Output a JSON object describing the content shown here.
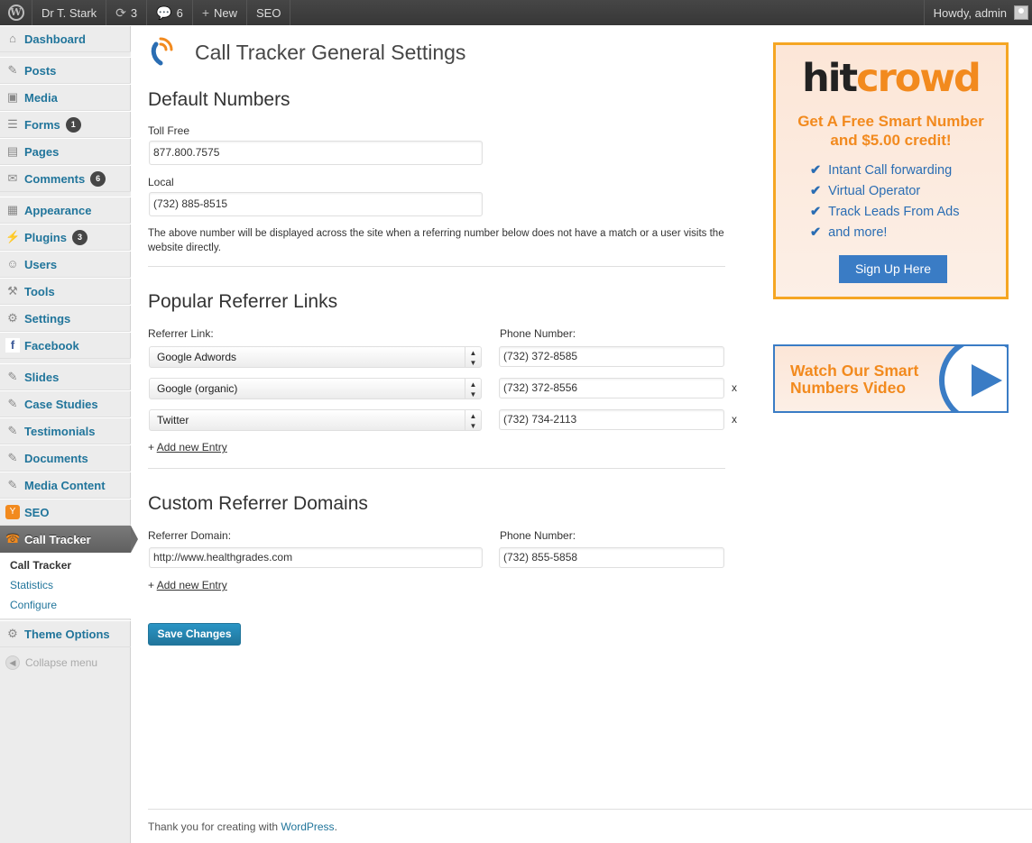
{
  "admin_bar": {
    "wp_icon": "wordpress-logo-icon",
    "site_name": "Dr T. Stark",
    "updates_count": "3",
    "comments_count": "6",
    "new_label": "New",
    "seo_label": "SEO",
    "howdy": "Howdy, admin"
  },
  "sidebar": {
    "items": [
      {
        "label": "Dashboard",
        "icon": "dashboard-icon"
      },
      {
        "label": "Posts",
        "icon": "pin-icon"
      },
      {
        "label": "Media",
        "icon": "media-icon"
      },
      {
        "label": "Forms",
        "icon": "forms-icon",
        "badge": "1"
      },
      {
        "label": "Pages",
        "icon": "pages-icon"
      },
      {
        "label": "Comments",
        "icon": "comments-icon",
        "badge": "6"
      },
      {
        "label": "Appearance",
        "icon": "appearance-icon"
      },
      {
        "label": "Plugins",
        "icon": "plugins-icon",
        "badge": "3"
      },
      {
        "label": "Users",
        "icon": "users-icon"
      },
      {
        "label": "Tools",
        "icon": "tools-icon"
      },
      {
        "label": "Settings",
        "icon": "settings-icon"
      },
      {
        "label": "Facebook",
        "icon": "facebook-icon"
      },
      {
        "label": "Slides",
        "icon": "pin-icon"
      },
      {
        "label": "Case Studies",
        "icon": "pin-icon"
      },
      {
        "label": "Testimonials",
        "icon": "pin-icon"
      },
      {
        "label": "Documents",
        "icon": "pin-icon"
      },
      {
        "label": "Media Content",
        "icon": "pin-icon"
      },
      {
        "label": "SEO",
        "icon": "seo-icon"
      },
      {
        "label": "Call Tracker",
        "icon": "call-tracker-icon"
      },
      {
        "label": "Theme Options",
        "icon": "gear-icon"
      }
    ],
    "submenu": [
      "Call Tracker",
      "Statistics",
      "Configure"
    ],
    "collapse_label": "Collapse menu"
  },
  "main": {
    "title": "Call Tracker General Settings",
    "default_numbers": {
      "heading": "Default Numbers",
      "toll_free_label": "Toll Free",
      "toll_free_value": "877.800.7575",
      "local_label": "Local",
      "local_value": "(732) 885-8515",
      "description": "The above number will be displayed across the site when a referring number below does not have a match or a user visits the website directly."
    },
    "popular_referrers": {
      "heading": "Popular Referrer Links",
      "link_label": "Referrer Link:",
      "phone_label": "Phone Number:",
      "rows": [
        {
          "link": "Google Adwords",
          "phone": "(732) 372-8585"
        },
        {
          "link": "Google (organic)",
          "phone": "(732) 372-8556",
          "remove": "x"
        },
        {
          "link": "Twitter",
          "phone": "(732) 734-2113",
          "remove": "x"
        }
      ],
      "add_prefix": "+",
      "add_label": "Add new Entry"
    },
    "custom_domains": {
      "heading": "Custom Referrer Domains",
      "domain_label": "Referrer Domain:",
      "phone_label": "Phone Number:",
      "domain_value": "http://www.healthgrades.com",
      "phone_value": "(732) 855-5858",
      "add_prefix": "+",
      "add_label": "Add new Entry"
    },
    "save_label": "Save Changes"
  },
  "ads": {
    "hitcrowd": {
      "brand_part1": "hit",
      "brand_part2": "crowd",
      "headline_line1": "Get A Free Smart Number",
      "headline_line2": "and $5.00 credit!",
      "features": [
        "Intant Call forwarding",
        "Virtual Operator",
        "Track Leads From Ads",
        "and more!"
      ],
      "cta": "Sign Up Here"
    },
    "video": {
      "line1": "Watch Our Smart",
      "line2": "Numbers Video",
      "icon": "play-icon"
    }
  },
  "footer": {
    "text": "Thank you for creating with",
    "link": "WordPress",
    "suffix": "."
  },
  "colors": {
    "admin_blue": "#21759b",
    "accent_orange": "#f28a1e",
    "ad_blue": "#3a7cc5"
  }
}
